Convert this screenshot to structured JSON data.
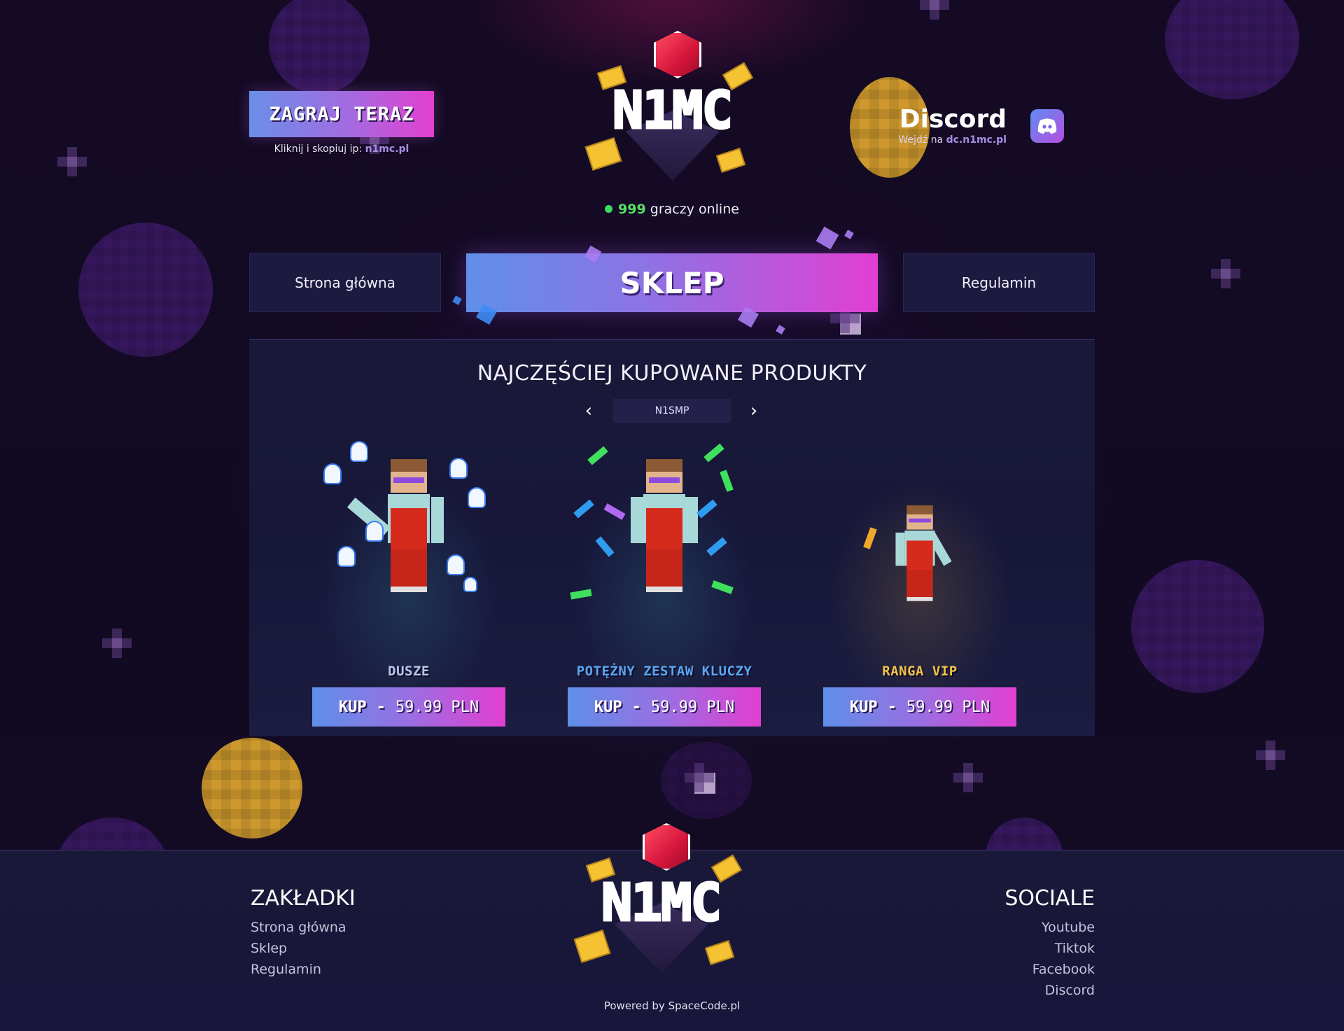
{
  "header": {
    "play_button": "ZAGRAJ TERAZ",
    "play_hint_prefix": "Kliknij i skopiuj ip:",
    "server_ip": "n1mc.pl",
    "logo_text": "N1MC",
    "online_count": "999",
    "online_label": "graczy online",
    "discord": {
      "title": "Discord",
      "subtitle_prefix": "Wejdź na",
      "link": "dc.n1mc.pl"
    }
  },
  "nav": {
    "home": "Strona główna",
    "shop": "SKLEP",
    "rules": "Regulamin"
  },
  "panel": {
    "title": "NAJCZĘŚCIEJ KUPOWANE PRODUKTY",
    "server": "N1SMP",
    "prev_icon": "chevron-left-icon",
    "next_icon": "chevron-right-icon"
  },
  "products": [
    {
      "name": "DUSZE",
      "buy": "KUP",
      "sep": "-",
      "price": "59.99 PLN",
      "name_color": "#b9c6ea"
    },
    {
      "name": "POTĘŻNY ZESTAW KLUCZY",
      "buy": "KUP",
      "sep": "-",
      "price": "59.99 PLN",
      "name_color": "#5aa6f2"
    },
    {
      "name": "RANGA VIP",
      "buy": "KUP",
      "sep": "-",
      "price": "59.99 PLN",
      "name_color": "#f2c148"
    }
  ],
  "footer": {
    "tabs_title": "ZAKŁADKI",
    "tabs": [
      "Strona główna",
      "Sklep",
      "Regulamin"
    ],
    "social_title": "SOCIALE",
    "socials": [
      "Youtube",
      "Tiktok",
      "Facebook",
      "Discord"
    ],
    "powered": "Powered by SpaceCode.pl"
  },
  "colors": {
    "accent_gradient_start": "#5f8fe9",
    "accent_gradient_end": "#e23fd2",
    "online_green": "#3ddc5d"
  }
}
